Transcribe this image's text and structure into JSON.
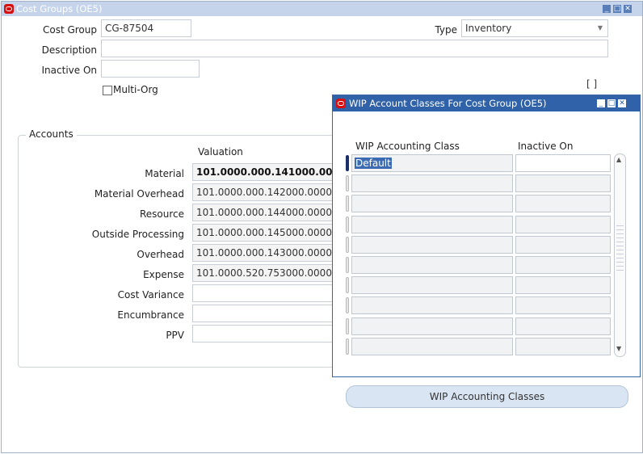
{
  "main_window": {
    "title": "Cost Groups (OE5)",
    "controls": {
      "minimize": "_",
      "maximize": "□",
      "close": "✕"
    }
  },
  "header": {
    "cost_group_label": "Cost Group",
    "cost_group_value": "CG-87504",
    "type_label": "Type",
    "type_value": "Inventory",
    "description_label": "Description",
    "description_value": "",
    "inactive_on_label": "Inactive On",
    "inactive_on_value": "",
    "multi_org_label": "Multi-Org",
    "multi_org_checked": false
  },
  "accounts": {
    "legend": "Accounts",
    "valuation_header": "Valuation",
    "rows": [
      {
        "label": "Material",
        "value": "101.0000.000.141000.0000.0"
      },
      {
        "label": "Material Overhead",
        "value": "101.0000.000.142000.0000.0"
      },
      {
        "label": "Resource",
        "value": "101.0000.000.144000.0000.0"
      },
      {
        "label": "Outside Processing",
        "value": "101.0000.000.145000.0000.0"
      },
      {
        "label": "Overhead",
        "value": "101.0000.000.143000.0000.0"
      },
      {
        "label": "Expense",
        "value": "101.0000.520.753000.0000.0"
      },
      {
        "label": "Cost Variance",
        "value": ""
      },
      {
        "label": "Encumbrance",
        "value": ""
      },
      {
        "label": "PPV",
        "value": ""
      }
    ]
  },
  "wip_window": {
    "title": "WIP Account Classes For Cost Group (OE5)",
    "controls": {
      "minimize": "_",
      "maximize": "□",
      "close": "✕"
    },
    "col_class": "WIP Accounting Class",
    "col_inactive": "Inactive On",
    "rows": [
      {
        "class": "Default",
        "inactive": ""
      },
      {
        "class": "",
        "inactive": ""
      },
      {
        "class": "",
        "inactive": ""
      },
      {
        "class": "",
        "inactive": ""
      },
      {
        "class": "",
        "inactive": ""
      },
      {
        "class": "",
        "inactive": ""
      },
      {
        "class": "",
        "inactive": ""
      },
      {
        "class": "",
        "inactive": ""
      },
      {
        "class": "",
        "inactive": ""
      },
      {
        "class": "",
        "inactive": ""
      }
    ]
  },
  "wip_button": {
    "label": "WIP Accounting Classes"
  },
  "bracket": {
    "text": "[  ]"
  },
  "colors": {
    "accent": "#2f62a8",
    "titlebar_inactive": "#c5d4ea",
    "oracle_red": "#d90f0f"
  },
  "icons": {
    "dropdown": "chevron-down-icon",
    "scroll_up": "arrow-up-icon",
    "scroll_down": "arrow-down-icon"
  }
}
